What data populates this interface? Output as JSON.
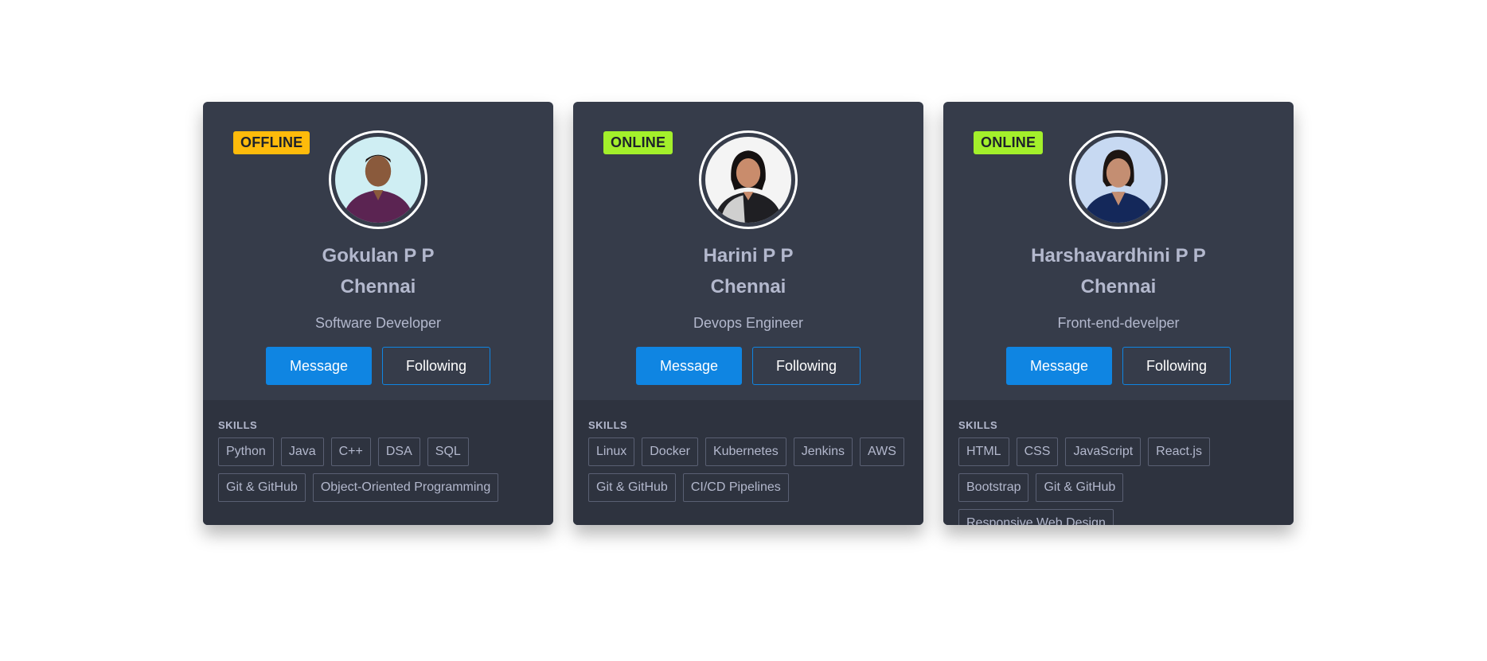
{
  "skills_heading": "SKILLS",
  "colors": {
    "card_bg": "#363c4a",
    "skills_bg": "#2e333f",
    "text": "#b3b8cd",
    "primary": "#0f85e2",
    "offline_badge": "#febb0b",
    "online_badge": "#a3f02b"
  },
  "cards": [
    {
      "status": "OFFLINE",
      "status_color": "#febb0b",
      "name": "Gokulan P P",
      "city": "Chennai",
      "role": "Software Developer",
      "message_label": "Message",
      "following_label": "Following",
      "avatar": "profile-photo",
      "skills": [
        "Python",
        "Java",
        "C++",
        "DSA",
        "SQL",
        "Git & GitHub",
        "Object-Oriented Programming"
      ]
    },
    {
      "status": "ONLINE",
      "status_color": "#a3f02b",
      "name": "Harini P P",
      "city": "Chennai",
      "role": "Devops Engineer",
      "message_label": "Message",
      "following_label": "Following",
      "avatar": "profile-photo",
      "skills": [
        "Linux",
        "Docker",
        "Kubernetes",
        "Jenkins",
        "AWS",
        "Git & GitHub",
        "CI/CD Pipelines"
      ]
    },
    {
      "status": "ONLINE",
      "status_color": "#a3f02b",
      "name": "Harshavardhini P P",
      "city": "Chennai",
      "role": "Front-end-develper",
      "message_label": "Message",
      "following_label": "Following",
      "avatar": "profile-photo",
      "skills": [
        "HTML",
        "CSS",
        "JavaScript",
        "React.js",
        "Bootstrap",
        "Git & GitHub",
        "Responsive Web Design"
      ]
    }
  ]
}
